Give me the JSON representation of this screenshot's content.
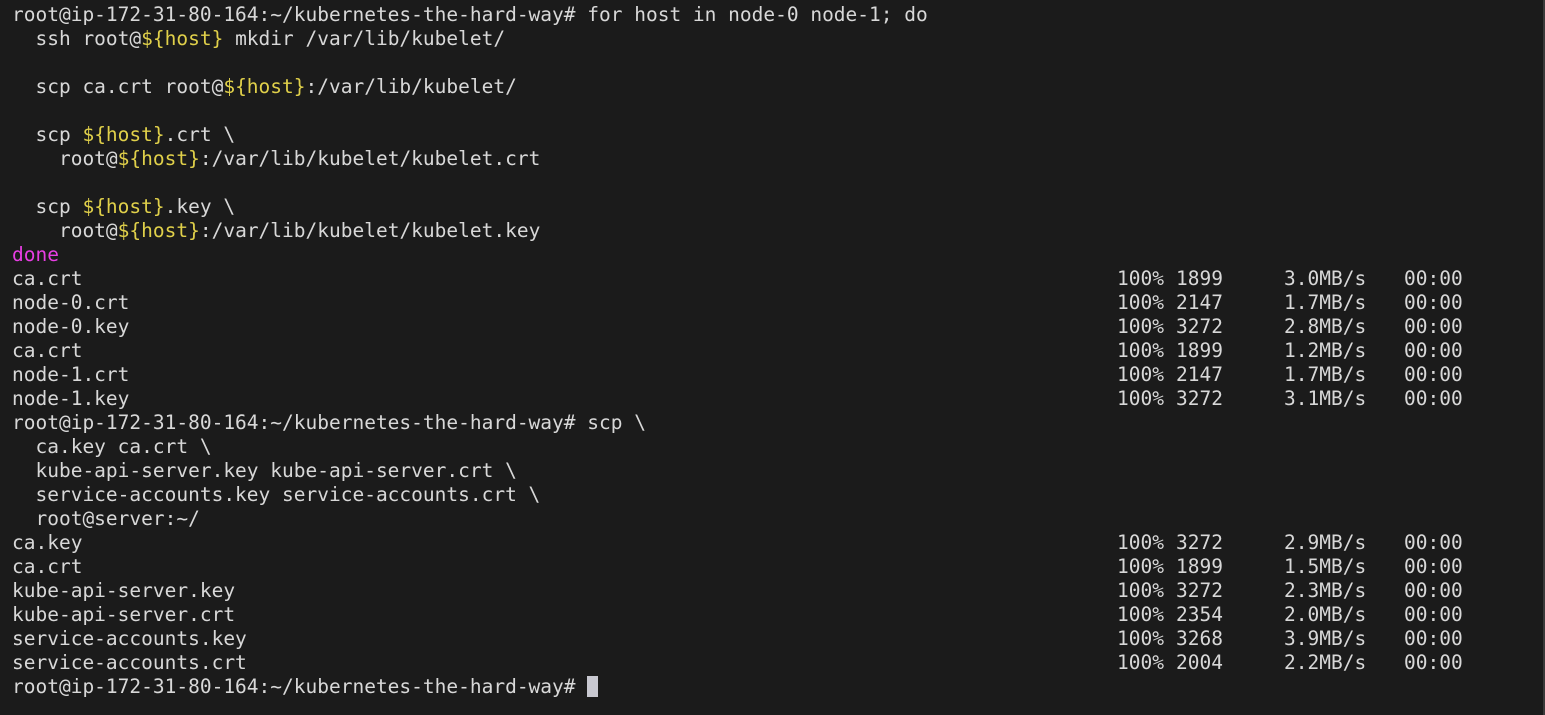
{
  "prompt": "root@ip-172-31-80-164:~/kubernetes-the-hard-way# ",
  "command1": {
    "l1_cmd": "for host in node-0 node-1; do",
    "l2_a": "  ssh root@",
    "l2_b": " mkdir /var/lib/kubelet/",
    "l4_a": "  scp ca.crt root@",
    "l4_b": ":/var/lib/kubelet/",
    "l6_a": "  scp ",
    "l6_b": ".crt \\",
    "l7_a": "    root@",
    "l7_b": ":/var/lib/kubelet/kubelet.crt",
    "l9_a": "  scp ",
    "l9_b": ".key \\",
    "l10_a": "    root@",
    "l10_b": ":/var/lib/kubelet/kubelet.key",
    "var": "${host}",
    "done": "done"
  },
  "transfers1": [
    {
      "name": "ca.crt",
      "pct": "100%",
      "size": "1899",
      "rate": "3.0MB/s",
      "eta": "00:00"
    },
    {
      "name": "node-0.crt",
      "pct": "100%",
      "size": "2147",
      "rate": "1.7MB/s",
      "eta": "00:00"
    },
    {
      "name": "node-0.key",
      "pct": "100%",
      "size": "3272",
      "rate": "2.8MB/s",
      "eta": "00:00"
    },
    {
      "name": "ca.crt",
      "pct": "100%",
      "size": "1899",
      "rate": "1.2MB/s",
      "eta": "00:00"
    },
    {
      "name": "node-1.crt",
      "pct": "100%",
      "size": "2147",
      "rate": "1.7MB/s",
      "eta": "00:00"
    },
    {
      "name": "node-1.key",
      "pct": "100%",
      "size": "3272",
      "rate": "3.1MB/s",
      "eta": "00:00"
    }
  ],
  "command2": {
    "l1_cmd": "scp \\",
    "l2": "  ca.key ca.crt \\",
    "l3": "  kube-api-server.key kube-api-server.crt \\",
    "l4": "  service-accounts.key service-accounts.crt \\",
    "l5": "  root@server:~/"
  },
  "transfers2": [
    {
      "name": "ca.key",
      "pct": "100%",
      "size": "3272",
      "rate": "2.9MB/s",
      "eta": "00:00"
    },
    {
      "name": "ca.crt",
      "pct": "100%",
      "size": "1899",
      "rate": "1.5MB/s",
      "eta": "00:00"
    },
    {
      "name": "kube-api-server.key",
      "pct": "100%",
      "size": "3272",
      "rate": "2.3MB/s",
      "eta": "00:00"
    },
    {
      "name": "kube-api-server.crt",
      "pct": "100%",
      "size": "2354",
      "rate": "2.0MB/s",
      "eta": "00:00"
    },
    {
      "name": "service-accounts.key",
      "pct": "100%",
      "size": "3268",
      "rate": "3.9MB/s",
      "eta": "00:00"
    },
    {
      "name": "service-accounts.crt",
      "pct": "100%",
      "size": "2004",
      "rate": "2.2MB/s",
      "eta": "00:00"
    }
  ],
  "colors": {
    "background": "#1b1b1b",
    "foreground": "#d8d8d8",
    "variable": "#e0d04a",
    "keyword": "#e83ee4",
    "cursor": "#c8c8d0"
  }
}
